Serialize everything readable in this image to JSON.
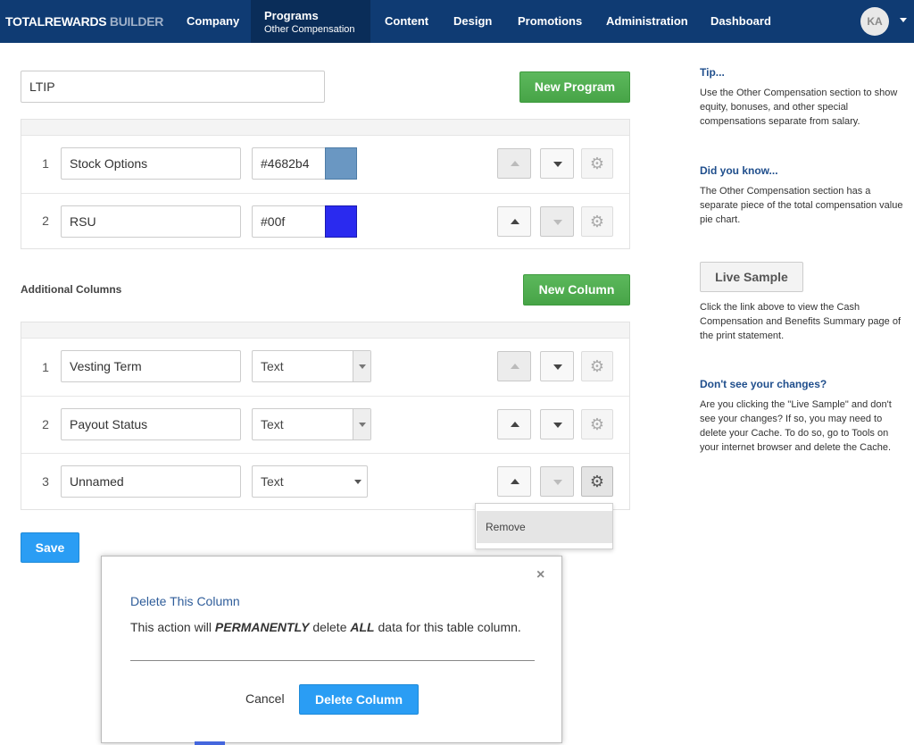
{
  "nav": {
    "brand_part1": "TOTALREWARDS",
    "brand_part2": "BUILDER",
    "items": [
      {
        "label": "Company"
      },
      {
        "label": "Programs",
        "sub": "Other Compensation"
      },
      {
        "label": "Content"
      },
      {
        "label": "Design"
      },
      {
        "label": "Promotions"
      },
      {
        "label": "Administration"
      },
      {
        "label": "Dashboard"
      }
    ],
    "avatar_initials": "KA"
  },
  "program": {
    "name_value": "LTIP",
    "new_program_label": "New Program",
    "items": [
      {
        "num": "1",
        "name": "Stock Options",
        "color": "#4682b4"
      },
      {
        "num": "2",
        "name": "RSU",
        "color": "#00f"
      }
    ]
  },
  "columns": {
    "section_label": "Additional Columns",
    "new_column_label": "New Column",
    "items": [
      {
        "num": "1",
        "name": "Vesting Term",
        "type": "Text"
      },
      {
        "num": "2",
        "name": "Payout Status",
        "type": "Text"
      },
      {
        "num": "3",
        "name": "Unnamed",
        "type": "Text"
      }
    ],
    "menu_remove_label": "Remove"
  },
  "save_label": "Save",
  "sidebar": {
    "tip_title": "Tip...",
    "tip_text": "Use the Other Compensation section to show equity, bonuses, and other special compensations separate from salary.",
    "did_you_know_title": "Did you know...",
    "did_you_know_text": "The Other Compensation section has a separate piece of the total compensation value pie chart.",
    "live_sample_label": "Live Sample",
    "live_sample_text": "Click the link above to view the Cash Compensation and Benefits Summary page of the print statement.",
    "changes_title": "Don't see your changes?",
    "changes_text": "Are you clicking the \"Live Sample\" and don't see your changes? If so, you may need to delete your Cache. To do so, go to Tools on your internet browser and delete the Cache."
  },
  "modal": {
    "close_glyph": "×",
    "title": "Delete This Column",
    "body_prefix": "This action will ",
    "body_strong1": "PERMANENTLY",
    "body_mid": " delete ",
    "body_strong2": "ALL",
    "body_suffix": " data for this table column.",
    "cancel_label": "Cancel",
    "confirm_label": "Delete Column"
  },
  "colors": {
    "nav_bg": "#0f3b73",
    "accent_green": "#5cb85c",
    "accent_blue": "#2a9df4",
    "heading_blue": "#1f4e8c"
  }
}
